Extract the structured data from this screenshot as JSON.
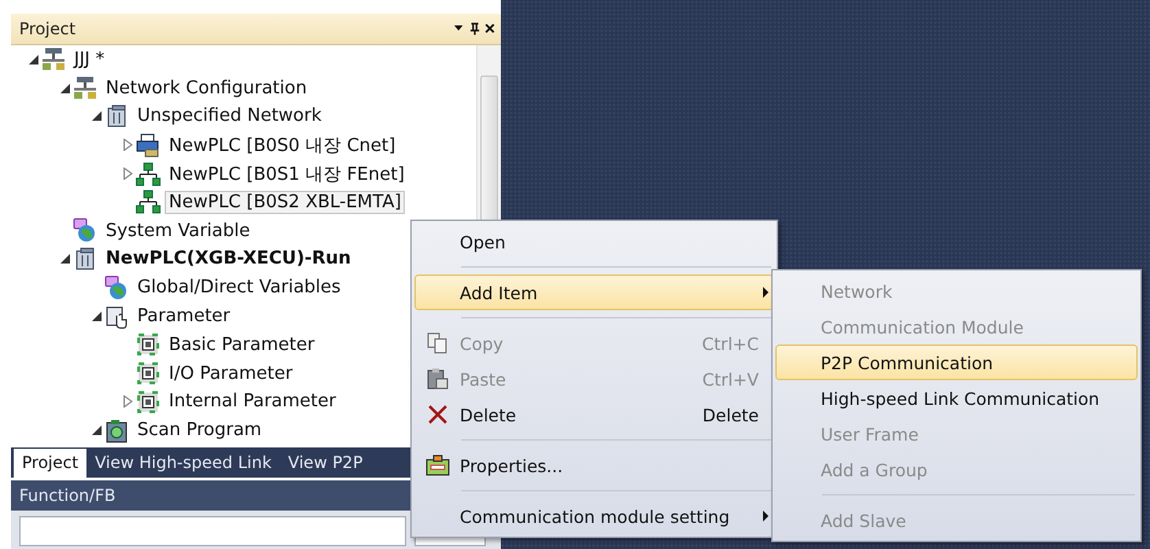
{
  "project_panel": {
    "title": "Project",
    "tree": [
      {
        "label": "JJJ *",
        "kind": "project",
        "expanded": true,
        "children": [
          {
            "label": "Network Configuration",
            "kind": "network",
            "expanded": true,
            "children": [
              {
                "label": "Unspecified Network",
                "kind": "module",
                "expanded": true,
                "children": [
                  {
                    "label": "NewPLC [B0S0 내장 Cnet]",
                    "kind": "serial",
                    "expanded": false
                  },
                  {
                    "label": "NewPLC [B0S1 내장 FEnet]",
                    "kind": "ethernet",
                    "expanded": false
                  },
                  {
                    "label": "NewPLC [B0S2 XBL-EMTA]",
                    "kind": "ethernet",
                    "selected": true
                  }
                ]
              }
            ]
          },
          {
            "label": "System Variable",
            "kind": "globe"
          },
          {
            "label": "NewPLC(XGB-XECU)-Run",
            "kind": "module",
            "bold": true,
            "expanded": true,
            "children": [
              {
                "label": "Global/Direct Variables",
                "kind": "globe"
              },
              {
                "label": "Parameter",
                "kind": "param",
                "expanded": true,
                "children": [
                  {
                    "label": "Basic Parameter",
                    "kind": "paramfile"
                  },
                  {
                    "label": "I/O Parameter",
                    "kind": "paramfile"
                  },
                  {
                    "label": "Internal Parameter",
                    "kind": "paramfile",
                    "expanded": false
                  }
                ]
              },
              {
                "label": "Scan Program",
                "kind": "program",
                "expanded": true
              }
            ]
          }
        ]
      }
    ],
    "tabs": [
      {
        "label": "Project",
        "selected": true
      },
      {
        "label": "View High-speed Link",
        "selected": false
      },
      {
        "label": "View P2P",
        "selected": false
      }
    ]
  },
  "function_panel": {
    "title": "Function/FB"
  },
  "context_menu": [
    {
      "kind": "item",
      "label": "Open"
    },
    {
      "kind": "separator"
    },
    {
      "kind": "item",
      "label": "Add Item",
      "selected": true,
      "submenu": true
    },
    {
      "kind": "separator"
    },
    {
      "kind": "copy",
      "label": "Copy",
      "shortcut": "Ctrl+C",
      "disabled": true
    },
    {
      "kind": "paste",
      "label": "Paste",
      "shortcut": "Ctrl+V",
      "disabled": true
    },
    {
      "kind": "delete",
      "label": "Delete",
      "shortcut": "Delete"
    },
    {
      "kind": "separator"
    },
    {
      "kind": "properties",
      "label": "Properties..."
    },
    {
      "kind": "separator"
    },
    {
      "kind": "item",
      "label": "Communication module setting",
      "submenu": true
    }
  ],
  "submenu": [
    {
      "kind": "item",
      "label": "Network",
      "disabled": true
    },
    {
      "kind": "item",
      "label": "Communication Module",
      "disabled": true
    },
    {
      "kind": "item",
      "label": "P2P Communication",
      "selected": true
    },
    {
      "kind": "item",
      "label": "High-speed Link Communication"
    },
    {
      "kind": "item",
      "label": "User Frame",
      "disabled": true
    },
    {
      "kind": "item",
      "label": "Add a Group",
      "disabled": true
    },
    {
      "kind": "separator"
    },
    {
      "kind": "item",
      "label": "Add Slave",
      "disabled": true
    }
  ]
}
